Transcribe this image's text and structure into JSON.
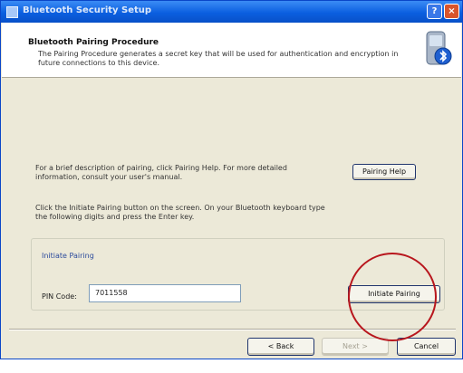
{
  "window": {
    "title": "Bluetooth Security Setup"
  },
  "titlebar": {
    "help_glyph": "?",
    "close_glyph": "×"
  },
  "header": {
    "title": "Bluetooth Pairing Procedure",
    "subtitle": "The Pairing Procedure generates a secret key that will be used for authentication and encryption in future connections to this device.",
    "icon": "bluetooth-device-icon"
  },
  "body": {
    "help_text": "For a brief description of pairing, click Pairing Help.  For more detailed information, consult your user's manual.",
    "instruction_text": "Click the Initiate Pairing button on the screen.  On your Bluetooth keyboard type the following digits and press the Enter key.",
    "pairing_help_label": "Pairing Help"
  },
  "pairing_group": {
    "label": "Initiate Pairing",
    "pin_label": "PIN Code:",
    "pin_value": "7011558",
    "initiate_label": "Initiate Pairing"
  },
  "footer": {
    "back_label": "< Back",
    "next_label": "Next >",
    "cancel_label": "Cancel"
  },
  "annotation": {
    "color": "#b8161d"
  }
}
